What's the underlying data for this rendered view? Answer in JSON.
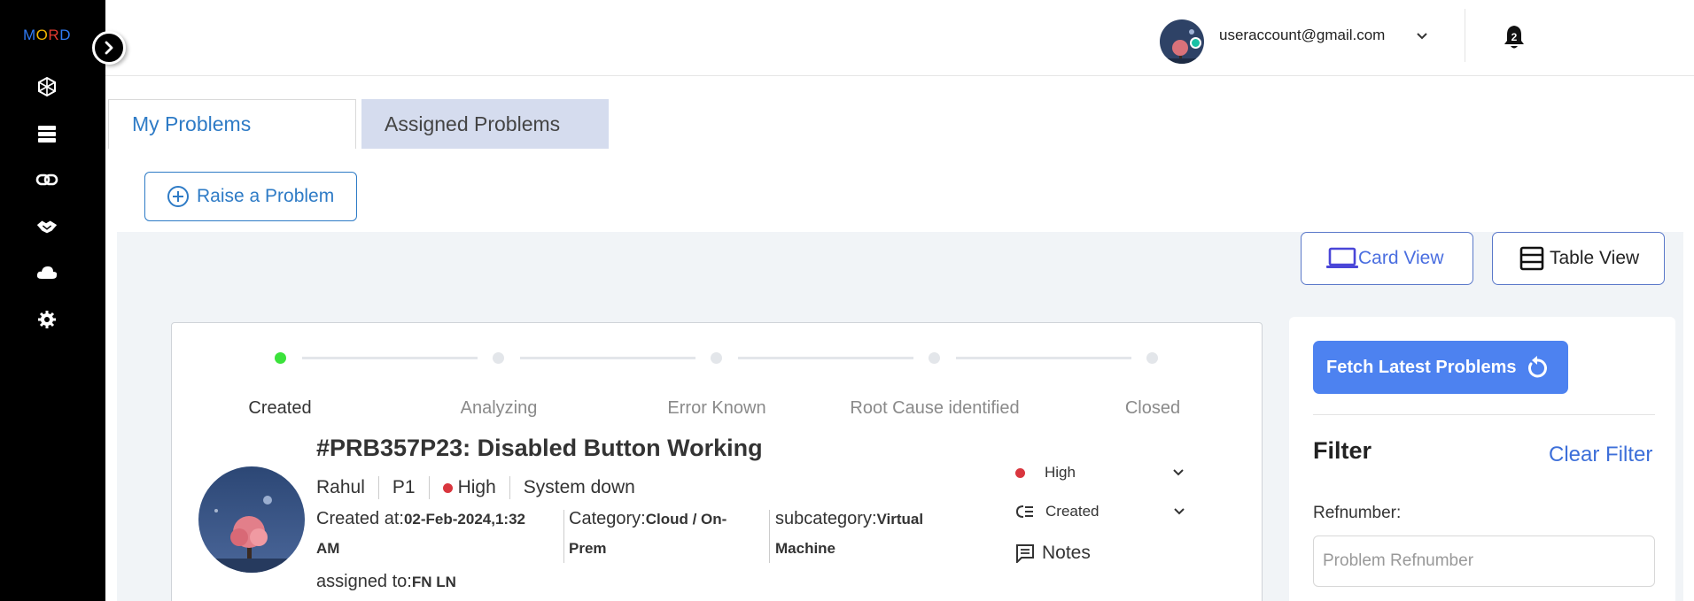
{
  "sidebar": {
    "logo": [
      "M",
      "O",
      "R",
      "D"
    ],
    "logo_colors": [
      "#2f7bf5",
      "#f0b400",
      "#e33a2f",
      "#2f7bf5"
    ],
    "items": [
      {
        "icon": "network-icon"
      },
      {
        "icon": "server-icon"
      },
      {
        "icon": "link-icon"
      },
      {
        "icon": "handshake-icon"
      },
      {
        "icon": "cloud-icon"
      },
      {
        "icon": "settings-icon"
      }
    ]
  },
  "header": {
    "user_email": "useraccount@gmail.com",
    "notification_count": "2"
  },
  "tabs": [
    {
      "label": "My Problems",
      "active": true
    },
    {
      "label": "Assigned Problems",
      "active": false
    }
  ],
  "actions": {
    "raise_label": "Raise a Problem",
    "card_view_label": "Card View",
    "table_view_label": "Table View"
  },
  "problem": {
    "steps": [
      "Created",
      "Analyzing",
      "Error Known",
      "Root Cause identified",
      "Closed"
    ],
    "active_step": "Created",
    "title": "#PRB357P23: Disabled Button Working",
    "owner": "Rahul",
    "priority": "P1",
    "severity": "High",
    "impact": "System down",
    "created_label": "Created at:",
    "created_value": "02-Feb-2024,1:32",
    "created_value_cont": "AM",
    "category_label": "Category:",
    "category_value": "Cloud / On-",
    "category_value_cont": "Prem",
    "subcategory_label": "subcategory:",
    "subcategory_value": "Virtual",
    "subcategory_value_cont": "Machine",
    "assigned_label": "assigned to:",
    "assigned_value": "FN LN",
    "severity_select": "High",
    "status_select": "Created",
    "notes_label": "Notes"
  },
  "filter": {
    "fetch_label": "Fetch Latest Problems",
    "title": "Filter",
    "clear_label": "Clear Filter",
    "ref_label": "Refnumber:",
    "ref_placeholder": "Problem Refnumber",
    "ref_value": ""
  },
  "colors": {
    "accent": "#2e7bc6",
    "fetch_button": "#4d82f0",
    "active_step": "#3be23b",
    "severity_high": "#d9363e",
    "online": "#19c1a5"
  }
}
